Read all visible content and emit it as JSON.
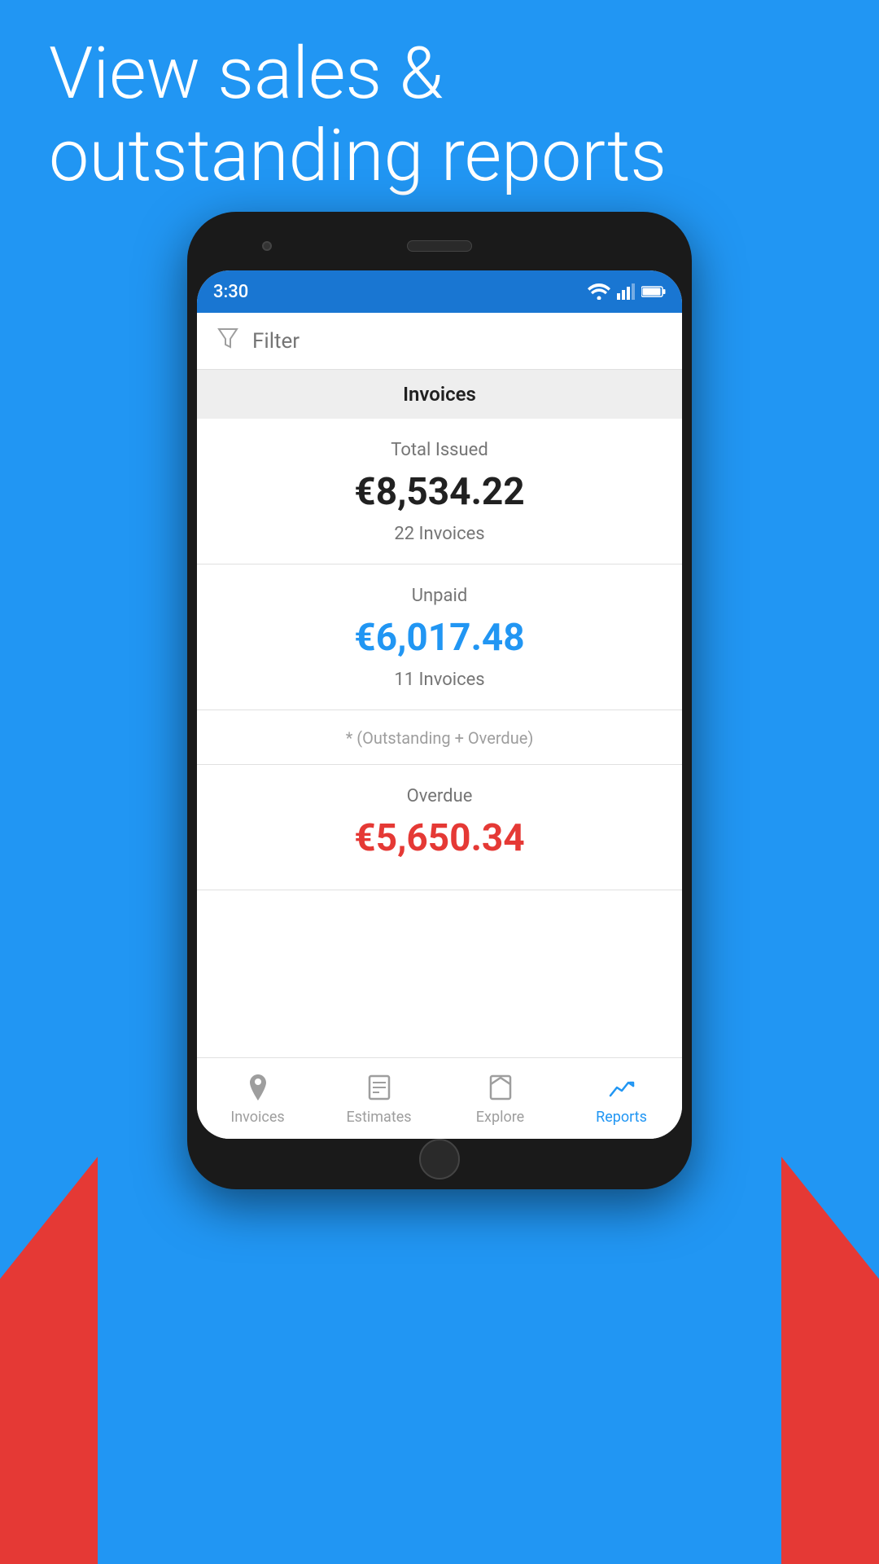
{
  "hero": {
    "text_line1": "View sales &",
    "text_line2": "outstanding reports"
  },
  "status_bar": {
    "time": "3:30"
  },
  "filter": {
    "label": "Filter"
  },
  "sections": {
    "invoices_header": "Invoices",
    "total_issued_label": "Total Issued",
    "total_issued_amount": "€8,534.22",
    "total_issued_count": "22 Invoices",
    "unpaid_label": "Unpaid",
    "unpaid_amount": "€6,017.48",
    "unpaid_count": "11 Invoices",
    "note": "* (Outstanding + Overdue)",
    "overdue_label": "Overdue",
    "overdue_amount": "€5,650.34"
  },
  "bottom_nav": {
    "items": [
      {
        "id": "invoices",
        "label": "Invoices",
        "active": false
      },
      {
        "id": "estimates",
        "label": "Estimates",
        "active": false
      },
      {
        "id": "explore",
        "label": "Explore",
        "active": false
      },
      {
        "id": "reports",
        "label": "Reports",
        "active": true
      }
    ]
  },
  "colors": {
    "blue": "#2196F3",
    "red": "#E53935",
    "dark_bg": "#1a1a1a"
  }
}
